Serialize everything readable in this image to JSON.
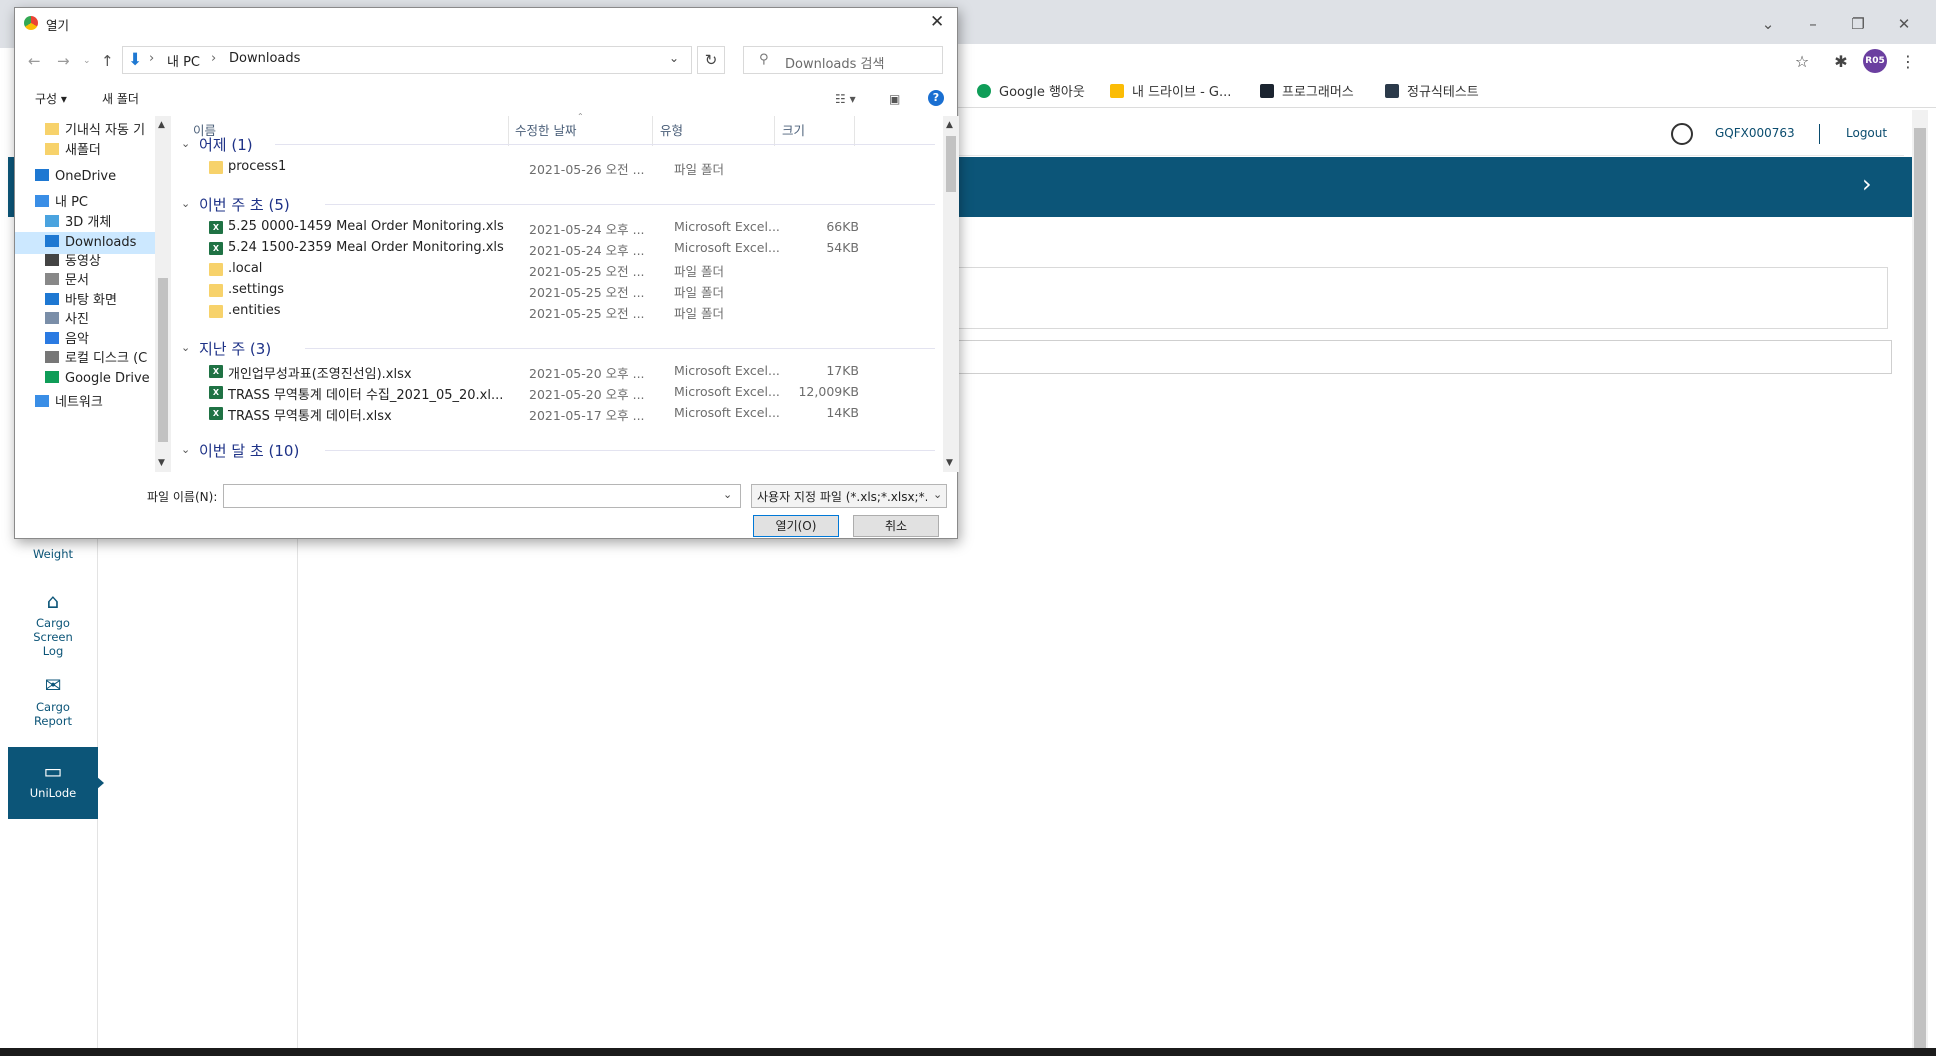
{
  "dialog": {
    "title": "열기",
    "breadcrumb": [
      "내 PC",
      "Downloads"
    ],
    "search_placeholder": "Downloads 검색",
    "toolbar": {
      "organize": "구성 ▾",
      "new_folder": "새 폴더"
    },
    "columns": {
      "name": "이름",
      "date": "수정한 날짜",
      "type": "유형",
      "size": "크기"
    },
    "tree": [
      {
        "label": "기내식 자동 기",
        "icon": "folder-icon"
      },
      {
        "label": "새폴더",
        "icon": "folder-icon"
      },
      {
        "label": "OneDrive",
        "icon": "cloud-icon"
      },
      {
        "label": "내 PC",
        "icon": "computer-icon"
      },
      {
        "label": "3D 개체",
        "icon": "cube-icon"
      },
      {
        "label": "Downloads",
        "icon": "download-icon"
      },
      {
        "label": "동영상",
        "icon": "video-icon"
      },
      {
        "label": "문서",
        "icon": "document-icon"
      },
      {
        "label": "바탕 화면",
        "icon": "desktop-icon"
      },
      {
        "label": "사진",
        "icon": "picture-icon"
      },
      {
        "label": "음악",
        "icon": "music-icon"
      },
      {
        "label": "로컬 디스크 (C",
        "icon": "disk-icon"
      },
      {
        "label": "Google Drive",
        "icon": "gdrive-icon"
      },
      {
        "label": "네트워크",
        "icon": "network-icon"
      }
    ],
    "groups": [
      {
        "header": "어제 (1)",
        "files": [
          {
            "name": "process1",
            "date": "2021-05-26 오전 ...",
            "type": "파일 폴더",
            "size": "",
            "kind": "folder"
          }
        ]
      },
      {
        "header": "이번 주 초 (5)",
        "files": [
          {
            "name": "5.25 0000-1459 Meal Order Monitoring.xls",
            "date": "2021-05-24 오후 ...",
            "type": "Microsoft Excel...",
            "size": "66KB",
            "kind": "excel"
          },
          {
            "name": "5.24 1500-2359 Meal Order Monitoring.xls",
            "date": "2021-05-24 오후 ...",
            "type": "Microsoft Excel...",
            "size": "54KB",
            "kind": "excel"
          },
          {
            "name": ".local",
            "date": "2021-05-25 오전 ...",
            "type": "파일 폴더",
            "size": "",
            "kind": "folder"
          },
          {
            "name": ".settings",
            "date": "2021-05-25 오전 ...",
            "type": "파일 폴더",
            "size": "",
            "kind": "folder"
          },
          {
            "name": ".entities",
            "date": "2021-05-25 오전 ...",
            "type": "파일 폴더",
            "size": "",
            "kind": "folder"
          }
        ]
      },
      {
        "header": "지난 주 (3)",
        "files": [
          {
            "name": "개인업무성과표(조영진선임).xlsx",
            "date": "2021-05-20 오후 ...",
            "type": "Microsoft Excel...",
            "size": "17KB",
            "kind": "excel"
          },
          {
            "name": "TRASS 무역통계 데이터 수집_2021_05_20.xl...",
            "date": "2021-05-20 오후 ...",
            "type": "Microsoft Excel...",
            "size": "12,009KB",
            "kind": "excel"
          },
          {
            "name": "TRASS 무역통계 데이터.xlsx",
            "date": "2021-05-17 오후 ...",
            "type": "Microsoft Excel...",
            "size": "14KB",
            "kind": "excel"
          }
        ]
      },
      {
        "header": "이번 달 초 (10)",
        "files": []
      }
    ],
    "filename_label": "파일 이름(N):",
    "filename_value": "",
    "filter": "사용자 지정 파일 (*.xls;*.xlsx;*.",
    "open_button": "열기(O)",
    "cancel_button": "취소"
  },
  "browser": {
    "bookmarks": [
      {
        "label": "Google 행아웃",
        "color": "#0f9d58"
      },
      {
        "label": "내 드라이브 - G...",
        "color": "#fbbc05"
      },
      {
        "label": "프로그래머스",
        "color": "#1b2430"
      },
      {
        "label": "정규식테스트",
        "color": "#2b3a4a"
      }
    ],
    "avatar": "R05"
  },
  "app": {
    "user_id": "GQFX000763",
    "logout": "Logout",
    "nav": [
      {
        "label": "Weight",
        "icon": "scale-icon"
      },
      {
        "label": "Cargo Screen Log",
        "icon": "building-icon"
      },
      {
        "label": "Cargo Report",
        "icon": "mail-icon"
      },
      {
        "label": "UniLode",
        "icon": "card-icon"
      }
    ]
  }
}
